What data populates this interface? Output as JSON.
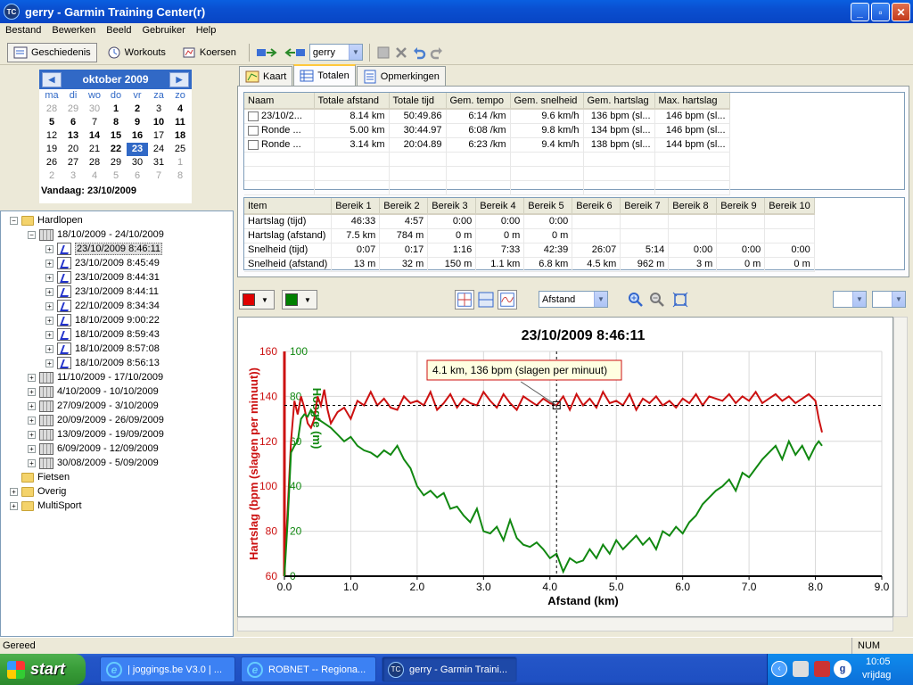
{
  "window": {
    "title": "gerry - Garmin Training Center(r)",
    "logo": "TC",
    "controls": [
      "_",
      "▫",
      "✕"
    ]
  },
  "menu": [
    "Bestand",
    "Bewerken",
    "Beeld",
    "Gebruiker",
    "Help"
  ],
  "toolbar": {
    "history": "Geschiedenis",
    "workouts": "Workouts",
    "courses": "Koersen",
    "user": "gerry"
  },
  "calendar": {
    "month": "oktober 2009",
    "dow": [
      "ma",
      "di",
      "wo",
      "do",
      "vr",
      "za",
      "zo"
    ],
    "weeks": [
      [
        "28",
        "29",
        "30",
        "1",
        "2",
        "3",
        "4"
      ],
      [
        "5",
        "6",
        "7",
        "8",
        "9",
        "10",
        "11"
      ],
      [
        "12",
        "13",
        "14",
        "15",
        "16",
        "17",
        "18"
      ],
      [
        "19",
        "20",
        "21",
        "22",
        "23",
        "24",
        "25"
      ],
      [
        "26",
        "27",
        "28",
        "29",
        "30",
        "31",
        "1"
      ],
      [
        "2",
        "3",
        "4",
        "5",
        "6",
        "7",
        "8"
      ]
    ],
    "today": "Vandaag: 23/10/2009"
  },
  "tree": {
    "root": "Hardlopen",
    "week_open": "18/10/2009 - 24/10/2009",
    "activities": [
      "23/10/2009 8:46:11",
      "23/10/2009 8:45:49",
      "23/10/2009 8:44:31",
      "23/10/2009 8:44:11",
      "22/10/2009 8:34:34",
      "18/10/2009 9:00:22",
      "18/10/2009 8:59:43",
      "18/10/2009 8:57:08",
      "18/10/2009 8:56:13"
    ],
    "weeks": [
      "11/10/2009 - 17/10/2009",
      "4/10/2009 - 10/10/2009",
      "27/09/2009 - 3/10/2009",
      "20/09/2009 - 26/09/2009",
      "13/09/2009 - 19/09/2009",
      "6/09/2009 - 12/09/2009",
      "30/08/2009 - 5/09/2009"
    ],
    "other": [
      "Fietsen",
      "Overig",
      "MultiSport"
    ]
  },
  "tabs": [
    "Kaart",
    "Totalen",
    "Opmerkingen"
  ],
  "laps": {
    "headers": [
      "Naam",
      "Totale afstand",
      "Totale tijd",
      "Gem. tempo",
      "Gem. snelheid",
      "Gem. hartslag",
      "Max. hartslag"
    ],
    "rows": [
      [
        "23/10/2...",
        "8.14 km",
        "50:49.86",
        "6:14 /km",
        "9.6 km/h",
        "136 bpm (sl...",
        "146 bpm (sl..."
      ],
      [
        "Ronde ...",
        "5.00 km",
        "30:44.97",
        "6:08 /km",
        "9.8 km/h",
        "134 bpm (sl...",
        "146 bpm (sl..."
      ],
      [
        "Ronde ...",
        "3.14 km",
        "20:04.89",
        "6:23 /km",
        "9.4 km/h",
        "138 bpm (sl...",
        "144 bpm (sl..."
      ]
    ]
  },
  "zones": {
    "headers": [
      "Item",
      "Bereik 1",
      "Bereik 2",
      "Bereik 3",
      "Bereik 4",
      "Bereik 5",
      "Bereik 6",
      "Bereik 7",
      "Bereik 8",
      "Bereik 9",
      "Bereik 10"
    ],
    "rows": [
      [
        "Hartslag (tijd)",
        "46:33",
        "4:57",
        "0:00",
        "0:00",
        "0:00",
        "",
        "",
        "",
        "",
        ""
      ],
      [
        "Hartslag (afstand)",
        "7.5 km",
        "784 m",
        "0 m",
        "0 m",
        "0 m",
        "",
        "",
        "",
        "",
        ""
      ],
      [
        "Snelheid (tijd)",
        "0:07",
        "0:17",
        "1:16",
        "7:33",
        "42:39",
        "26:07",
        "5:14",
        "0:00",
        "0:00",
        "0:00"
      ],
      [
        "Snelheid (afstand)",
        "13 m",
        "32 m",
        "150 m",
        "1.1 km",
        "6.8 km",
        "4.5 km",
        "962 m",
        "3 m",
        "0 m",
        "0 m"
      ]
    ]
  },
  "chart_toolbar": {
    "axis_select": "Afstand"
  },
  "chart_data": {
    "type": "line",
    "title": "23/10/2009 8:46:11",
    "xlabel": "Afstand (km)",
    "xlim": [
      0,
      9
    ],
    "xticks": [
      "0.0",
      "1.0",
      "2.0",
      "3.0",
      "4.0",
      "5.0",
      "6.0",
      "7.0",
      "8.0",
      "9.0"
    ],
    "y1label": "Hartslag (bpm (slagen per minuut))",
    "y1lim": [
      60,
      160
    ],
    "y1ticks": [
      "60",
      "80",
      "100",
      "120",
      "140",
      "160"
    ],
    "y2label": "Hoogte (m)",
    "y2lim": [
      0,
      100
    ],
    "y2ticks": [
      "0",
      "20",
      "40",
      "60",
      "80",
      "100"
    ],
    "colors": {
      "heart": "#cc1111",
      "elev": "#118811"
    },
    "tooltip": "4.1 km, 136 bpm (slagen per minuut)",
    "cursor": {
      "x": 4.1,
      "y": 136
    },
    "series": [
      {
        "name": "Hartslag",
        "axis": "y1",
        "x": [
          0.0,
          0.05,
          0.1,
          0.15,
          0.2,
          0.25,
          0.3,
          0.35,
          0.4,
          0.45,
          0.5,
          0.55,
          0.6,
          0.65,
          0.7,
          0.8,
          0.9,
          1.0,
          1.1,
          1.2,
          1.3,
          1.4,
          1.5,
          1.6,
          1.7,
          1.8,
          1.9,
          2.0,
          2.1,
          2.2,
          2.3,
          2.4,
          2.5,
          2.6,
          2.7,
          2.8,
          2.9,
          3.0,
          3.1,
          3.2,
          3.3,
          3.4,
          3.5,
          3.6,
          3.7,
          3.8,
          3.9,
          4.0,
          4.1,
          4.2,
          4.3,
          4.4,
          4.5,
          4.6,
          4.7,
          4.8,
          4.9,
          5.0,
          5.1,
          5.2,
          5.3,
          5.4,
          5.5,
          5.6,
          5.7,
          5.8,
          5.9,
          6.0,
          6.1,
          6.2,
          6.3,
          6.4,
          6.5,
          6.6,
          6.7,
          6.8,
          6.9,
          7.0,
          7.1,
          7.2,
          7.3,
          7.4,
          7.5,
          7.6,
          7.7,
          7.8,
          7.9,
          8.0,
          8.05,
          8.1
        ],
        "values": [
          62,
          90,
          120,
          138,
          132,
          140,
          135,
          128,
          126,
          130,
          140,
          136,
          143,
          134,
          128,
          133,
          135,
          130,
          138,
          136,
          142,
          136,
          139,
          135,
          134,
          140,
          137,
          138,
          136,
          142,
          134,
          137,
          141,
          135,
          139,
          137,
          136,
          142,
          138,
          135,
          141,
          137,
          134,
          140,
          138,
          136,
          139,
          137,
          136,
          140,
          134,
          141,
          136,
          139,
          135,
          142,
          137,
          138,
          136,
          141,
          134,
          139,
          137,
          140,
          136,
          138,
          135,
          139,
          137,
          141,
          136,
          140,
          139,
          138,
          141,
          137,
          140,
          138,
          142,
          137,
          139,
          141,
          138,
          140,
          137,
          139,
          141,
          138,
          130,
          124
        ]
      },
      {
        "name": "Hoogte",
        "axis": "y2",
        "x": [
          0.0,
          0.05,
          0.1,
          0.15,
          0.2,
          0.25,
          0.3,
          0.35,
          0.4,
          0.5,
          0.6,
          0.7,
          0.8,
          0.9,
          1.0,
          1.1,
          1.2,
          1.3,
          1.4,
          1.5,
          1.6,
          1.7,
          1.8,
          1.9,
          2.0,
          2.1,
          2.2,
          2.3,
          2.4,
          2.5,
          2.6,
          2.7,
          2.8,
          2.9,
          3.0,
          3.1,
          3.2,
          3.3,
          3.4,
          3.5,
          3.6,
          3.7,
          3.8,
          3.9,
          4.0,
          4.1,
          4.2,
          4.3,
          4.4,
          4.5,
          4.6,
          4.7,
          4.8,
          4.9,
          5.0,
          5.1,
          5.2,
          5.3,
          5.4,
          5.5,
          5.6,
          5.7,
          5.8,
          5.9,
          6.0,
          6.1,
          6.2,
          6.3,
          6.4,
          6.5,
          6.6,
          6.7,
          6.8,
          6.9,
          7.0,
          7.1,
          7.2,
          7.3,
          7.4,
          7.5,
          7.6,
          7.7,
          7.8,
          7.9,
          8.0,
          8.05,
          8.1
        ],
        "values": [
          0,
          25,
          55,
          58,
          60,
          70,
          72,
          71,
          74,
          70,
          68,
          66,
          63,
          60,
          62,
          58,
          56,
          55,
          53,
          56,
          54,
          58,
          52,
          48,
          40,
          36,
          38,
          35,
          37,
          30,
          31,
          27,
          24,
          30,
          20,
          19,
          22,
          16,
          25,
          17,
          14,
          13,
          15,
          12,
          8,
          10,
          2,
          8,
          6,
          7,
          12,
          8,
          14,
          10,
          16,
          12,
          15,
          18,
          14,
          17,
          12,
          20,
          18,
          22,
          19,
          24,
          27,
          32,
          35,
          38,
          40,
          43,
          38,
          46,
          44,
          48,
          52,
          55,
          58,
          52,
          60,
          54,
          58,
          52,
          58,
          60,
          58
        ]
      }
    ]
  },
  "status": {
    "text": "Gereed",
    "num": "NUM"
  },
  "taskbar": {
    "start": "start",
    "tasks": [
      "| joggings.be V3.0 | ...",
      "ROBNET -- Regiona...",
      "gerry - Garmin Traini..."
    ],
    "clock": "10:05",
    "day": "vrijdag"
  }
}
